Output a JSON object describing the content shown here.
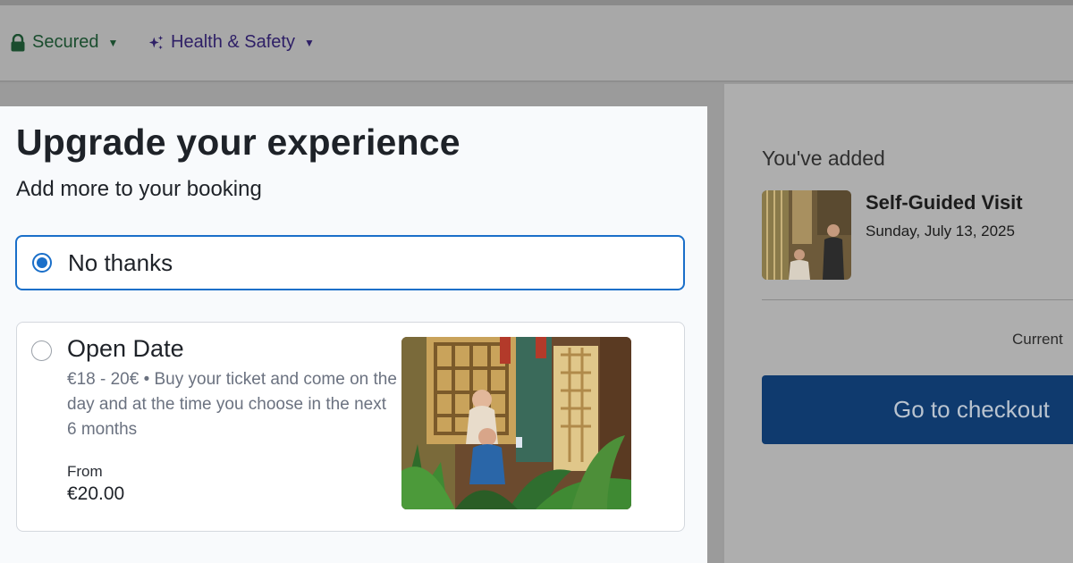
{
  "header": {
    "secured_label": "Secured",
    "health_label": "Health & Safety",
    "icons": [
      "lock-icon",
      "sparkle-icon",
      "caret-down-icon"
    ]
  },
  "modal": {
    "title": "Upgrade your experience",
    "subtitle": "Add more to your booking",
    "option_none": {
      "label": "No thanks",
      "selected": true
    },
    "option_open_date": {
      "title": "Open Date",
      "description": "€18 - 20€ • Buy your ticket and come on the day and at the time you choose in the next 6 months",
      "from_label": "From",
      "price": "€20.00",
      "selected": false
    }
  },
  "cart": {
    "added_label": "You've added",
    "item_name": "Self-Guided Visit",
    "item_date": "Sunday, July 13, 2025",
    "current_label": "Current",
    "checkout_label": "Go to checkout"
  },
  "colors": {
    "accent": "#1a6fc9",
    "checkout_button": "#0f3a6e",
    "overlay": "#9b9b9b"
  }
}
